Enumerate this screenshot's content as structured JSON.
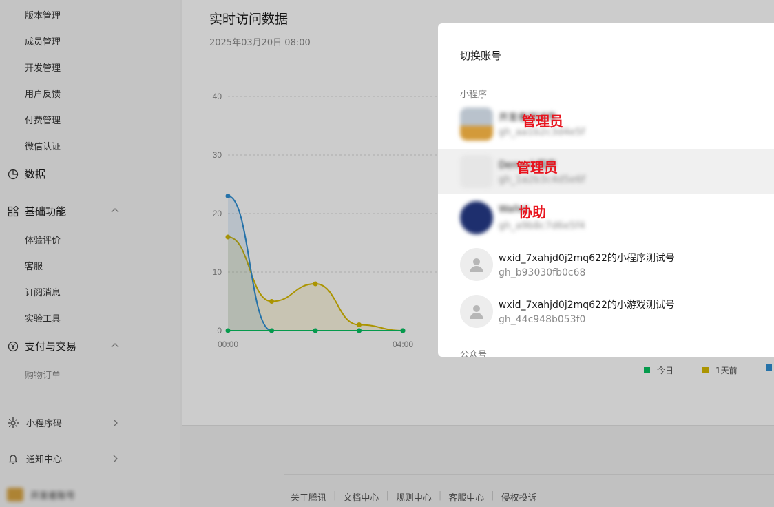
{
  "sidebar": {
    "top_items": [
      "版本管理",
      "成员管理",
      "开发管理",
      "用户反馈",
      "付费管理",
      "微信认证"
    ],
    "data_group": "数据",
    "basic_group": "基础功能",
    "basic_items": [
      "体验评价",
      "客服",
      "订阅消息",
      "实验工具"
    ],
    "pay_group": "支付与交易",
    "pay_items": [
      "购物订单"
    ],
    "bottom_items": [
      "小程序码",
      "通知中心"
    ],
    "account_name": "开发者账号"
  },
  "main": {
    "title": "实时访问数据",
    "subtitle": "2025年03月20日 08:00"
  },
  "chart_data": {
    "type": "line",
    "x": [
      "00:00",
      "01:00",
      "02:00",
      "03:00",
      "04:00"
    ],
    "x_ticks_shown": [
      "00:00",
      "04:00"
    ],
    "y_ticks": [
      0,
      10,
      20,
      30,
      40
    ],
    "ylim": [
      0,
      40
    ],
    "series": [
      {
        "name": "今日",
        "color": "#07c160",
        "values": [
          0,
          0,
          0,
          0,
          0
        ]
      },
      {
        "name": "1天前",
        "color": "#d6b900",
        "values": [
          16,
          5,
          8,
          1,
          0
        ]
      },
      {
        "name": "",
        "color": "#2f8fd4",
        "values": [
          23,
          0,
          0,
          0,
          0
        ]
      }
    ],
    "legend_position": "bottom-right"
  },
  "footer": {
    "links": [
      "关于腾讯",
      "文档中心",
      "规则中心",
      "客服中心",
      "侵权投诉"
    ]
  },
  "modal": {
    "title": "切换账号",
    "section_miniprogram": "小程序",
    "section_official": "公众号",
    "accounts": [
      {
        "name": "开发者测试号",
        "id": "gh_aa1b2c3d4e5f",
        "role": "管理员"
      },
      {
        "name": "Demo小程序",
        "id": "gh_1a2b3c4d5e6f",
        "role": "管理员"
      },
      {
        "name": "Wallet",
        "id": "gh_a9b8c7d6e5f4",
        "role": "协助"
      },
      {
        "name": "wxid_7xahjd0j2mq622的小程序测试号",
        "id": "gh_b93030fb0c68",
        "role": ""
      },
      {
        "name": "wxid_7xahjd0j2mq622的小游戏测试号",
        "id": "gh_44c948b053f0",
        "role": ""
      }
    ]
  }
}
